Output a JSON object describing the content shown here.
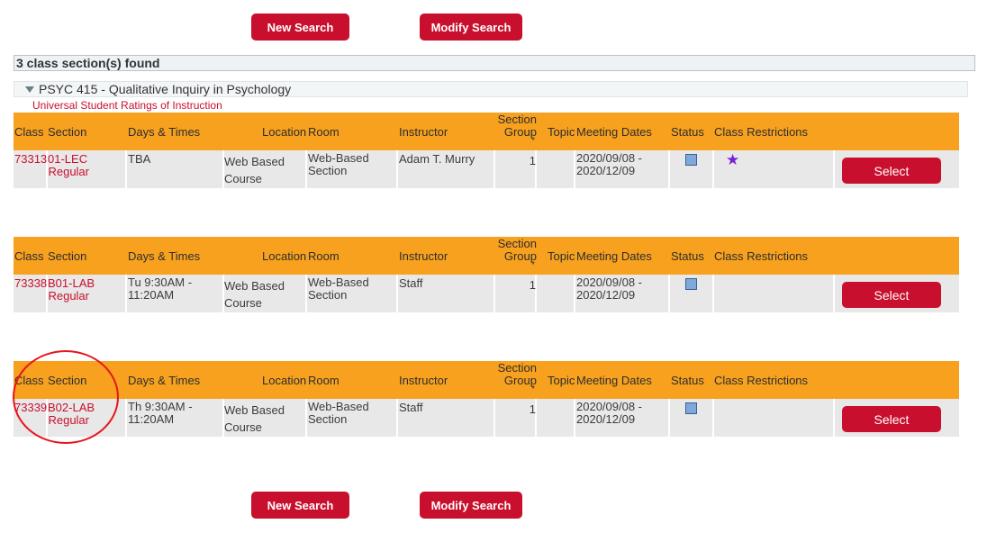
{
  "top_buttons": {
    "new_search": "New Search",
    "modify_search": "Modify Search"
  },
  "bottom_buttons": {
    "new_search": "New Search",
    "modify_search": "Modify Search"
  },
  "results_count": "3 class section(s) found",
  "course_title": "PSYC 415 - Qualitative Inquiry in Psychology",
  "ratings_link": "Universal Student Ratings of Instruction",
  "headers": {
    "class": "Class",
    "section": "Section",
    "days_times": "Days & Times",
    "location": "Location",
    "room": "Room",
    "instructor": "Instructor",
    "section_group": "Section Group",
    "section_group_mark": "*",
    "topic": "Topic",
    "meeting_dates": "Meeting Dates",
    "status": "Status",
    "class_restrictions": "Class Restrictions"
  },
  "sections": [
    {
      "class_nbr": "73313",
      "section": "01-LEC",
      "component": "Regular",
      "days_times": "TBA",
      "location": "Web Based Course",
      "room": "Web-Based Section",
      "instructor": "Adam T. Murry",
      "group": "1",
      "dates": "2020/09/08 - 2020/12/09",
      "status_icon": "open-square-icon",
      "restriction_icon": "star-icon",
      "select": "Select"
    },
    {
      "class_nbr": "73338",
      "section": "B01-LAB",
      "component": "Regular",
      "days_times": "Tu 9:30AM - 11:20AM",
      "location": "Web Based Course",
      "room": "Web-Based Section",
      "instructor": "Staff",
      "group": "1",
      "dates": "2020/09/08 - 2020/12/09",
      "status_icon": "open-square-icon",
      "select": "Select"
    },
    {
      "class_nbr": "73339",
      "section": "B02-LAB",
      "component": "Regular",
      "days_times": "Th 9:30AM - 11:20AM",
      "location": "Web Based Course",
      "room": "Web-Based Section",
      "instructor": "Staff",
      "group": "1",
      "dates": "2020/09/08 - 2020/12/09",
      "status_icon": "open-square-icon",
      "select": "Select"
    }
  ],
  "colors": {
    "header": "#f7a11e",
    "accent": "#c8102e",
    "row": "#e8e8e8",
    "annotation": "#e8141c",
    "star": "#7a1fd6"
  }
}
